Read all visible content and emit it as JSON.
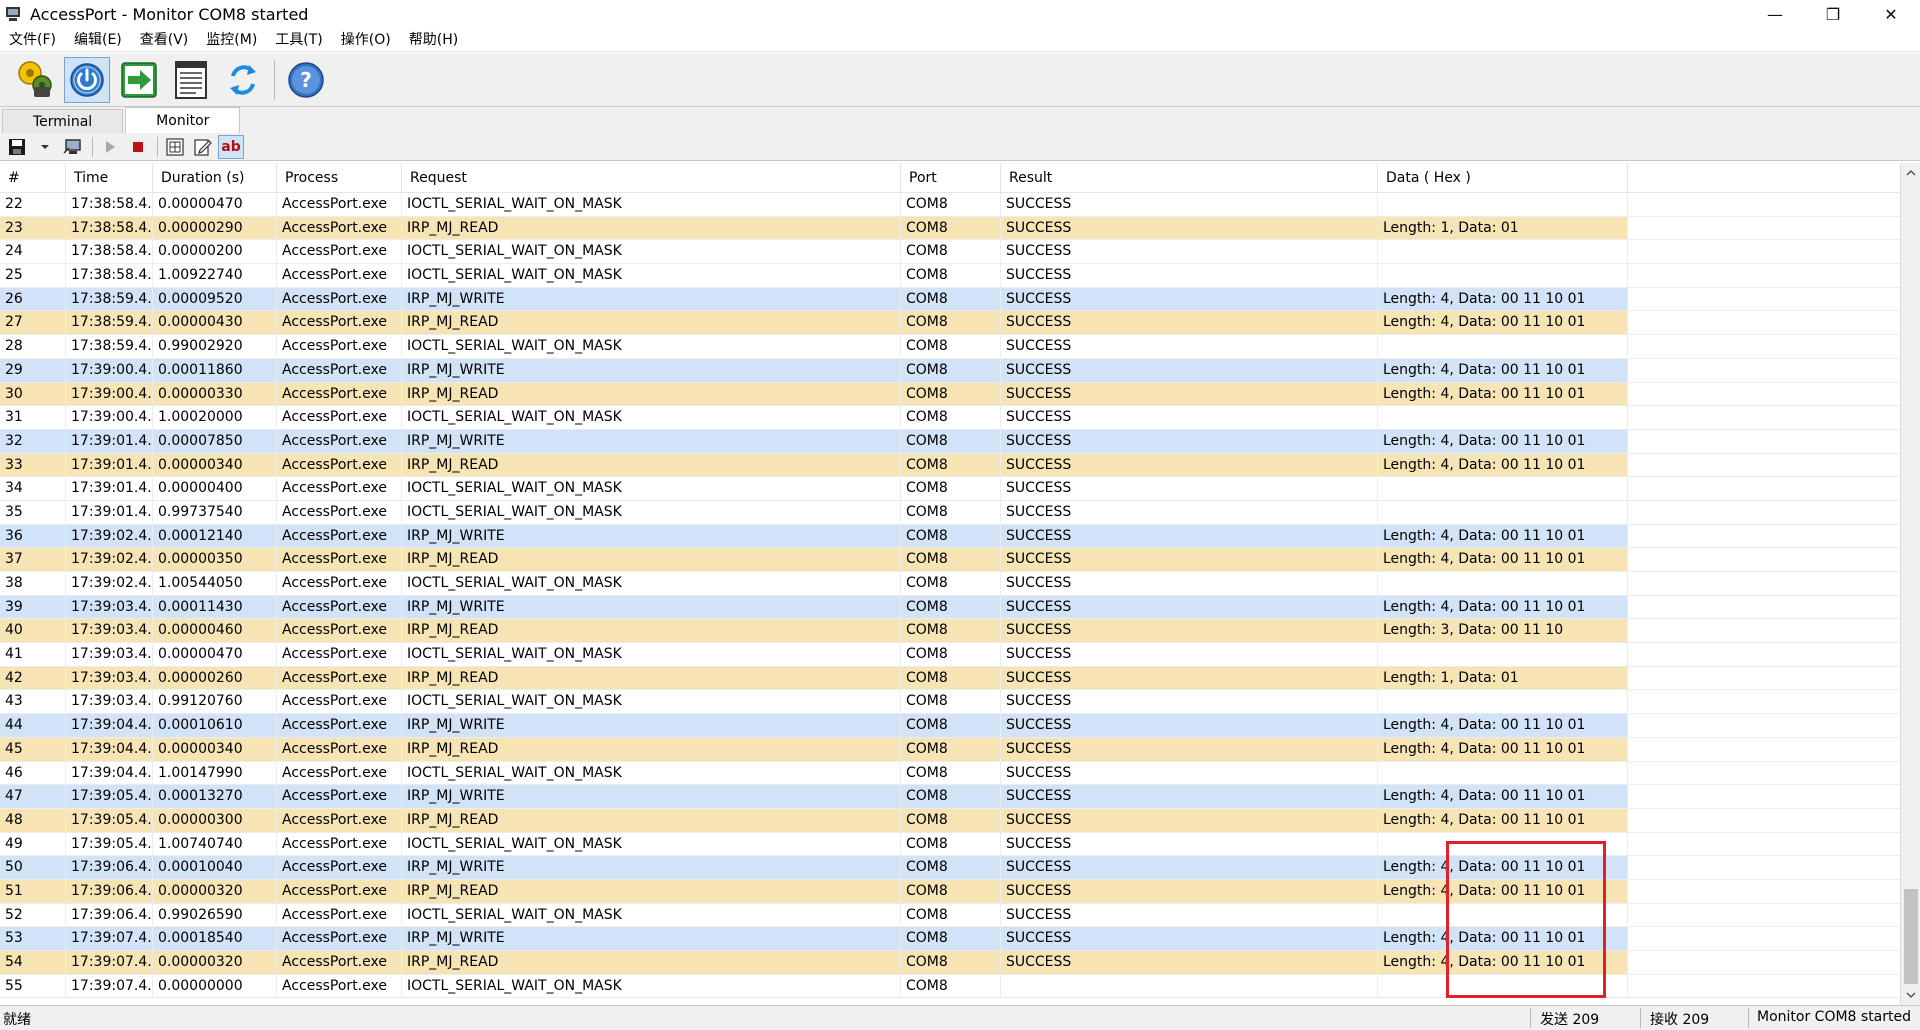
{
  "window": {
    "title": "AccessPort - Monitor COM8 started",
    "minimize": "—",
    "restore": "❐",
    "close": "✕"
  },
  "menu": [
    "文件(F)",
    "编辑(E)",
    "查看(V)",
    "监控(M)",
    "工具(T)",
    "操作(O)",
    "帮助(H)"
  ],
  "tabs": [
    "Terminal",
    "Monitor"
  ],
  "subtoolbar": {
    "ab_label": "ab"
  },
  "columns": [
    "#",
    "Time",
    "Duration (s)",
    "Process",
    "Request",
    "Port",
    "Result",
    "Data ( Hex )"
  ],
  "rows": [
    {
      "n": "22",
      "time": "17:38:58.4...",
      "dur": "0.00000470",
      "proc": "AccessPort.exe",
      "req": "IOCTL_SERIAL_WAIT_ON_MASK",
      "port": "COM8",
      "res": "SUCCESS",
      "data": "",
      "kind": "plain"
    },
    {
      "n": "23",
      "time": "17:38:58.4...",
      "dur": "0.00000290",
      "proc": "AccessPort.exe",
      "req": "IRP_MJ_READ",
      "port": "COM8",
      "res": "SUCCESS",
      "data": "Length: 1, Data: 01",
      "kind": "read"
    },
    {
      "n": "24",
      "time": "17:38:58.4...",
      "dur": "0.00000200",
      "proc": "AccessPort.exe",
      "req": "IOCTL_SERIAL_WAIT_ON_MASK",
      "port": "COM8",
      "res": "SUCCESS",
      "data": "",
      "kind": "plain"
    },
    {
      "n": "25",
      "time": "17:38:58.4...",
      "dur": "1.00922740",
      "proc": "AccessPort.exe",
      "req": "IOCTL_SERIAL_WAIT_ON_MASK",
      "port": "COM8",
      "res": "SUCCESS",
      "data": "",
      "kind": "plain"
    },
    {
      "n": "26",
      "time": "17:38:59.4...",
      "dur": "0.00009520",
      "proc": "AccessPort.exe",
      "req": "IRP_MJ_WRITE",
      "port": "COM8",
      "res": "SUCCESS",
      "data": "Length: 4, Data: 00 11 10 01",
      "kind": "write"
    },
    {
      "n": "27",
      "time": "17:38:59.4...",
      "dur": "0.00000430",
      "proc": "AccessPort.exe",
      "req": "IRP_MJ_READ",
      "port": "COM8",
      "res": "SUCCESS",
      "data": "Length: 4, Data: 00 11 10 01",
      "kind": "read"
    },
    {
      "n": "28",
      "time": "17:38:59.4...",
      "dur": "0.99002920",
      "proc": "AccessPort.exe",
      "req": "IOCTL_SERIAL_WAIT_ON_MASK",
      "port": "COM8",
      "res": "SUCCESS",
      "data": "",
      "kind": "plain"
    },
    {
      "n": "29",
      "time": "17:39:00.4...",
      "dur": "0.00011860",
      "proc": "AccessPort.exe",
      "req": "IRP_MJ_WRITE",
      "port": "COM8",
      "res": "SUCCESS",
      "data": "Length: 4, Data: 00 11 10 01",
      "kind": "write"
    },
    {
      "n": "30",
      "time": "17:39:00.4...",
      "dur": "0.00000330",
      "proc": "AccessPort.exe",
      "req": "IRP_MJ_READ",
      "port": "COM8",
      "res": "SUCCESS",
      "data": "Length: 4, Data: 00 11 10 01",
      "kind": "read"
    },
    {
      "n": "31",
      "time": "17:39:00.4...",
      "dur": "1.00020000",
      "proc": "AccessPort.exe",
      "req": "IOCTL_SERIAL_WAIT_ON_MASK",
      "port": "COM8",
      "res": "SUCCESS",
      "data": "",
      "kind": "plain"
    },
    {
      "n": "32",
      "time": "17:39:01.4...",
      "dur": "0.00007850",
      "proc": "AccessPort.exe",
      "req": "IRP_MJ_WRITE",
      "port": "COM8",
      "res": "SUCCESS",
      "data": "Length: 4, Data: 00 11 10 01",
      "kind": "write"
    },
    {
      "n": "33",
      "time": "17:39:01.4...",
      "dur": "0.00000340",
      "proc": "AccessPort.exe",
      "req": "IRP_MJ_READ",
      "port": "COM8",
      "res": "SUCCESS",
      "data": "Length: 4, Data: 00 11 10 01",
      "kind": "read"
    },
    {
      "n": "34",
      "time": "17:39:01.4...",
      "dur": "0.00000400",
      "proc": "AccessPort.exe",
      "req": "IOCTL_SERIAL_WAIT_ON_MASK",
      "port": "COM8",
      "res": "SUCCESS",
      "data": "",
      "kind": "plain"
    },
    {
      "n": "35",
      "time": "17:39:01.4...",
      "dur": "0.99737540",
      "proc": "AccessPort.exe",
      "req": "IOCTL_SERIAL_WAIT_ON_MASK",
      "port": "COM8",
      "res": "SUCCESS",
      "data": "",
      "kind": "plain"
    },
    {
      "n": "36",
      "time": "17:39:02.4...",
      "dur": "0.00012140",
      "proc": "AccessPort.exe",
      "req": "IRP_MJ_WRITE",
      "port": "COM8",
      "res": "SUCCESS",
      "data": "Length: 4, Data: 00 11 10 01",
      "kind": "write"
    },
    {
      "n": "37",
      "time": "17:39:02.4...",
      "dur": "0.00000350",
      "proc": "AccessPort.exe",
      "req": "IRP_MJ_READ",
      "port": "COM8",
      "res": "SUCCESS",
      "data": "Length: 4, Data: 00 11 10 01",
      "kind": "read"
    },
    {
      "n": "38",
      "time": "17:39:02.4...",
      "dur": "1.00544050",
      "proc": "AccessPort.exe",
      "req": "IOCTL_SERIAL_WAIT_ON_MASK",
      "port": "COM8",
      "res": "SUCCESS",
      "data": "",
      "kind": "plain"
    },
    {
      "n": "39",
      "time": "17:39:03.4...",
      "dur": "0.00011430",
      "proc": "AccessPort.exe",
      "req": "IRP_MJ_WRITE",
      "port": "COM8",
      "res": "SUCCESS",
      "data": "Length: 4, Data: 00 11 10 01",
      "kind": "write"
    },
    {
      "n": "40",
      "time": "17:39:03.4...",
      "dur": "0.00000460",
      "proc": "AccessPort.exe",
      "req": "IRP_MJ_READ",
      "port": "COM8",
      "res": "SUCCESS",
      "data": "Length: 3, Data: 00 11 10",
      "kind": "read"
    },
    {
      "n": "41",
      "time": "17:39:03.4...",
      "dur": "0.00000470",
      "proc": "AccessPort.exe",
      "req": "IOCTL_SERIAL_WAIT_ON_MASK",
      "port": "COM8",
      "res": "SUCCESS",
      "data": "",
      "kind": "plain"
    },
    {
      "n": "42",
      "time": "17:39:03.4...",
      "dur": "0.00000260",
      "proc": "AccessPort.exe",
      "req": "IRP_MJ_READ",
      "port": "COM8",
      "res": "SUCCESS",
      "data": "Length: 1, Data: 01",
      "kind": "read"
    },
    {
      "n": "43",
      "time": "17:39:03.4...",
      "dur": "0.99120760",
      "proc": "AccessPort.exe",
      "req": "IOCTL_SERIAL_WAIT_ON_MASK",
      "port": "COM8",
      "res": "SUCCESS",
      "data": "",
      "kind": "plain"
    },
    {
      "n": "44",
      "time": "17:39:04.4...",
      "dur": "0.00010610",
      "proc": "AccessPort.exe",
      "req": "IRP_MJ_WRITE",
      "port": "COM8",
      "res": "SUCCESS",
      "data": "Length: 4, Data: 00 11 10 01",
      "kind": "write"
    },
    {
      "n": "45",
      "time": "17:39:04.4...",
      "dur": "0.00000340",
      "proc": "AccessPort.exe",
      "req": "IRP_MJ_READ",
      "port": "COM8",
      "res": "SUCCESS",
      "data": "Length: 4, Data: 00 11 10 01",
      "kind": "read"
    },
    {
      "n": "46",
      "time": "17:39:04.4...",
      "dur": "1.00147990",
      "proc": "AccessPort.exe",
      "req": "IOCTL_SERIAL_WAIT_ON_MASK",
      "port": "COM8",
      "res": "SUCCESS",
      "data": "",
      "kind": "plain"
    },
    {
      "n": "47",
      "time": "17:39:05.4...",
      "dur": "0.00013270",
      "proc": "AccessPort.exe",
      "req": "IRP_MJ_WRITE",
      "port": "COM8",
      "res": "SUCCESS",
      "data": "Length: 4, Data: 00 11 10 01",
      "kind": "write"
    },
    {
      "n": "48",
      "time": "17:39:05.4...",
      "dur": "0.00000300",
      "proc": "AccessPort.exe",
      "req": "IRP_MJ_READ",
      "port": "COM8",
      "res": "SUCCESS",
      "data": "Length: 4, Data: 00 11 10 01",
      "kind": "read"
    },
    {
      "n": "49",
      "time": "17:39:05.4...",
      "dur": "1.00740740",
      "proc": "AccessPort.exe",
      "req": "IOCTL_SERIAL_WAIT_ON_MASK",
      "port": "COM8",
      "res": "SUCCESS",
      "data": "",
      "kind": "plain"
    },
    {
      "n": "50",
      "time": "17:39:06.4...",
      "dur": "0.00010040",
      "proc": "AccessPort.exe",
      "req": "IRP_MJ_WRITE",
      "port": "COM8",
      "res": "SUCCESS",
      "data": "Length: 4, Data: 00 11 10 01",
      "kind": "write"
    },
    {
      "n": "51",
      "time": "17:39:06.4...",
      "dur": "0.00000320",
      "proc": "AccessPort.exe",
      "req": "IRP_MJ_READ",
      "port": "COM8",
      "res": "SUCCESS",
      "data": "Length: 4, Data: 00 11 10 01",
      "kind": "read"
    },
    {
      "n": "52",
      "time": "17:39:06.4...",
      "dur": "0.99026590",
      "proc": "AccessPort.exe",
      "req": "IOCTL_SERIAL_WAIT_ON_MASK",
      "port": "COM8",
      "res": "SUCCESS",
      "data": "",
      "kind": "plain"
    },
    {
      "n": "53",
      "time": "17:39:07.4...",
      "dur": "0.00018540",
      "proc": "AccessPort.exe",
      "req": "IRP_MJ_WRITE",
      "port": "COM8",
      "res": "SUCCESS",
      "data": "Length: 4, Data: 00 11 10 01",
      "kind": "write"
    },
    {
      "n": "54",
      "time": "17:39:07.4...",
      "dur": "0.00000320",
      "proc": "AccessPort.exe",
      "req": "IRP_MJ_READ",
      "port": "COM8",
      "res": "SUCCESS",
      "data": "Length: 4, Data: 00 11 10 01",
      "kind": "read"
    },
    {
      "n": "55",
      "time": "17:39:07.4...",
      "dur": "0.00000000",
      "proc": "AccessPort.exe",
      "req": "IOCTL_SERIAL_WAIT_ON_MASK",
      "port": "COM8",
      "res": "",
      "data": "",
      "kind": "plain"
    }
  ],
  "status": {
    "left": "就绪",
    "sent": "发送 209",
    "received": "接收 209",
    "mode": "Monitor COM8 started"
  },
  "colors": {
    "write_row": "#d2e2f7",
    "read_row": "#f6e4b4",
    "highlight": "#e0202a"
  }
}
